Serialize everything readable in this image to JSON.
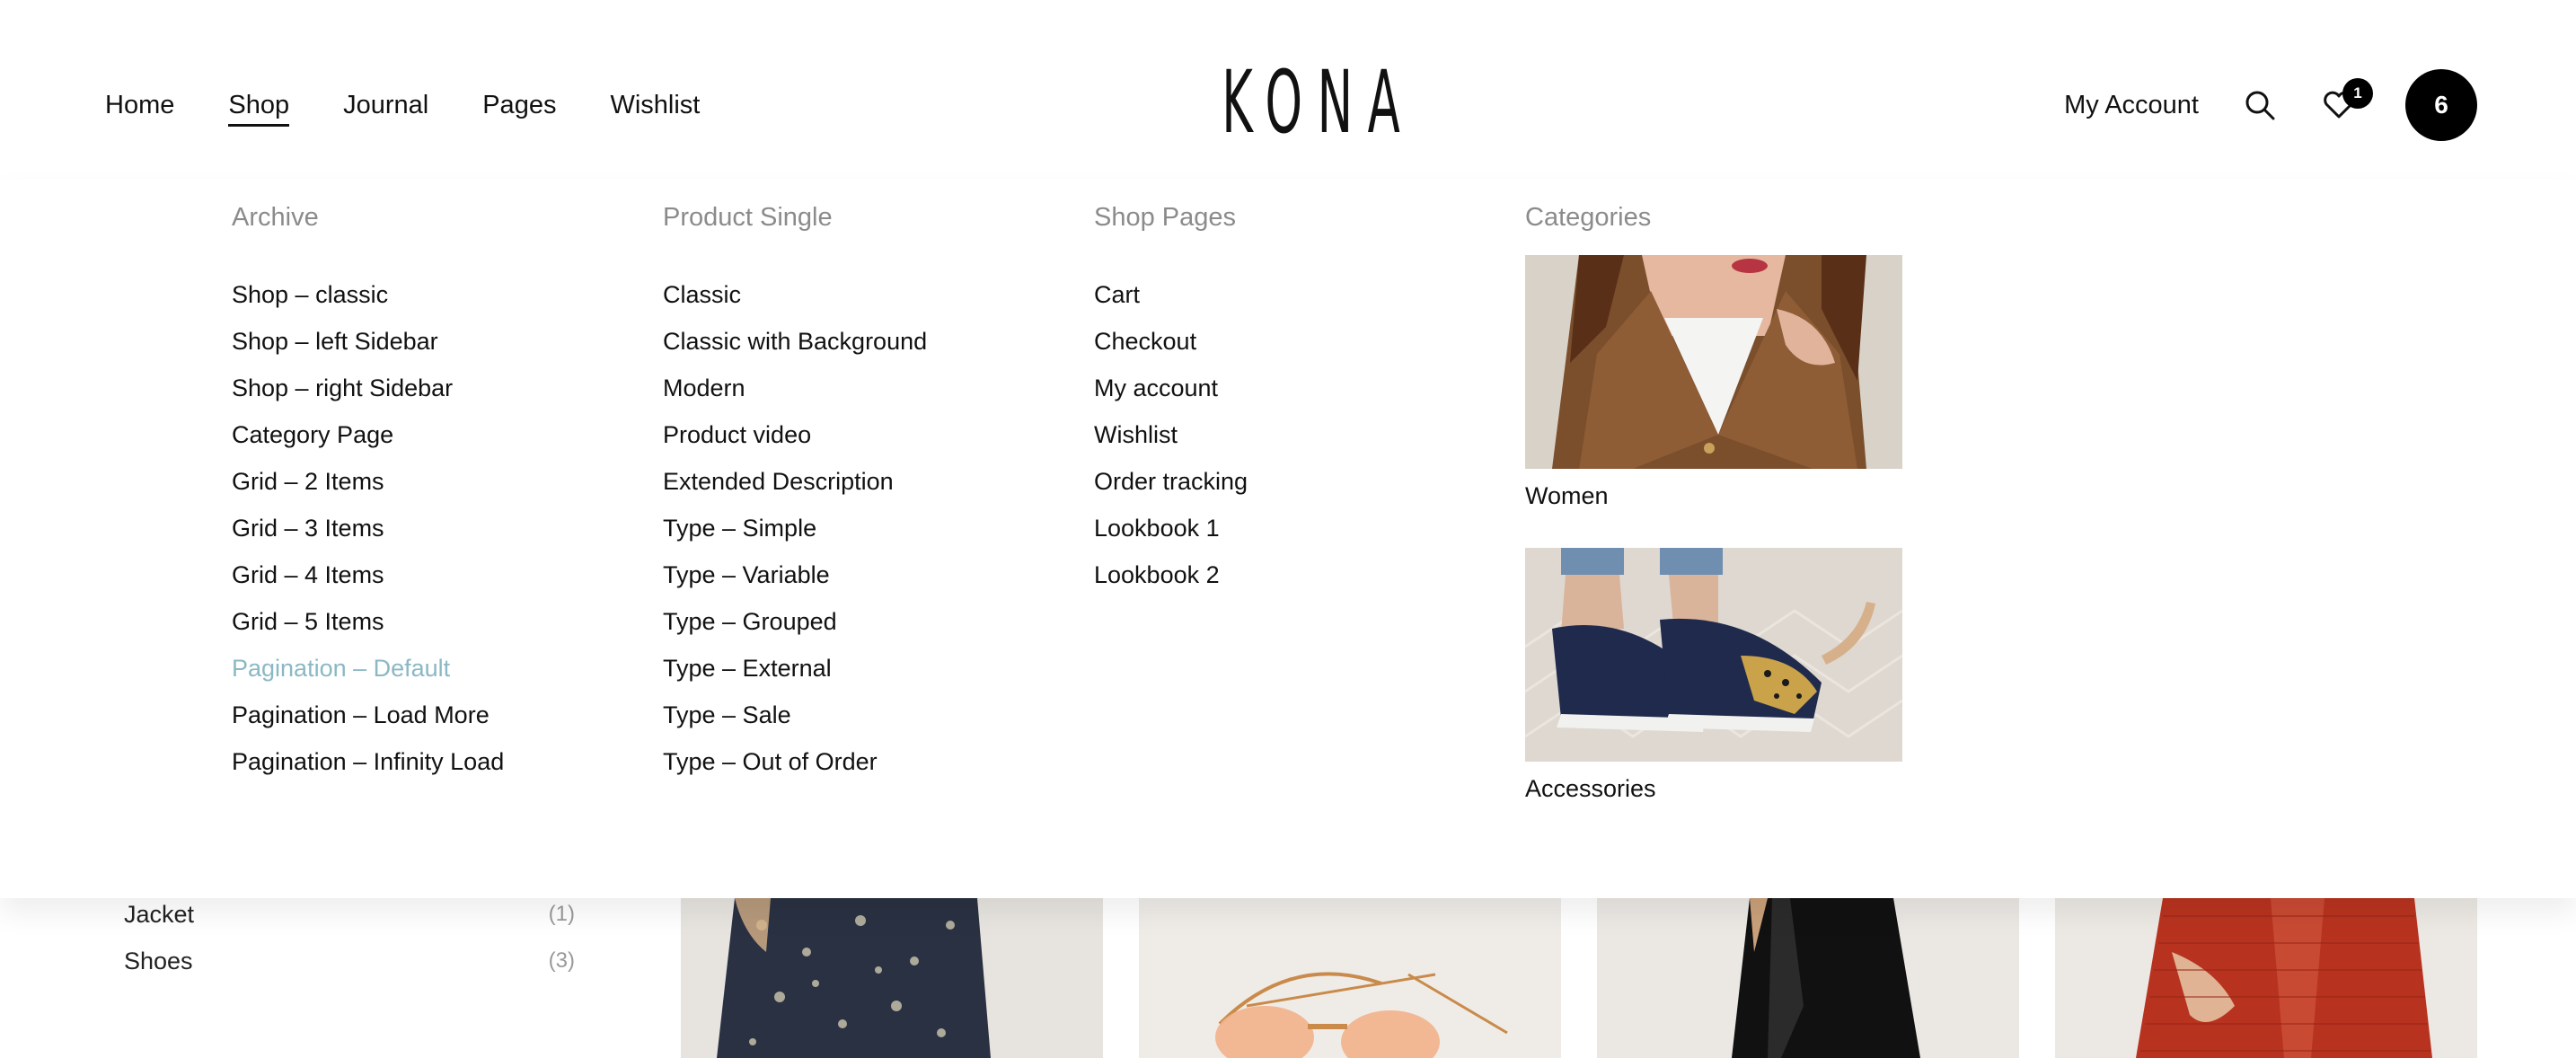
{
  "brand": {
    "logo_text": "KONA"
  },
  "nav": {
    "items": [
      {
        "label": "Home"
      },
      {
        "label": "Shop"
      },
      {
        "label": "Journal"
      },
      {
        "label": "Pages"
      },
      {
        "label": "Wishlist"
      }
    ],
    "active_index": 1
  },
  "header_right": {
    "account_label": "My Account",
    "search_icon": "search-icon",
    "wishlist_icon": "heart-icon",
    "wishlist_count": "1",
    "cart_count": "6"
  },
  "mega_menu": {
    "archive": {
      "heading": "Archive",
      "items": [
        "Shop – classic",
        "Shop – left Sidebar",
        "Shop – right Sidebar",
        "Category Page",
        "Grid – 2 Items",
        "Grid – 3 Items",
        "Grid – 4 Items",
        "Grid – 5 Items",
        "Pagination – Default",
        "Pagination – Load More",
        "Pagination – Infinity Load"
      ],
      "highlighted": "Pagination – Default"
    },
    "product_single": {
      "heading": "Product Single",
      "items": [
        "Classic",
        "Classic with Background",
        "Modern",
        "Product video",
        "Extended Description",
        "Type – Simple",
        "Type – Variable",
        "Type – Grouped",
        "Type – External",
        "Type – Sale",
        "Type – Out of Order"
      ]
    },
    "shop_pages": {
      "heading": "Shop Pages",
      "items": [
        "Cart",
        "Checkout",
        "My account",
        "Wishlist",
        "Order tracking",
        "Lookbook 1",
        "Lookbook 2"
      ]
    },
    "categories": {
      "heading": "Categories",
      "cards": [
        {
          "label": "Women"
        },
        {
          "label": "Accessories"
        }
      ]
    }
  },
  "sidebar": {
    "categories": [
      {
        "name": "Jacket",
        "count": "(1)"
      },
      {
        "name": "Shoes",
        "count": "(3)"
      }
    ]
  },
  "colors": {
    "accent_link": "#8ab8c4",
    "heading_gray": "#8b8b8b",
    "badge_black": "#000000"
  }
}
